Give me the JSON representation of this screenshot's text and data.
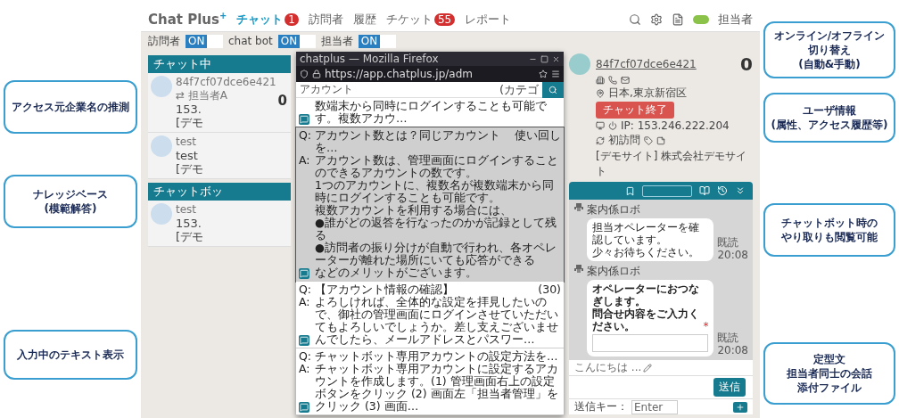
{
  "nav": {
    "logo": "Chat Plus",
    "logo_sup": "+",
    "tabs": [
      {
        "label": "チャット",
        "badge": "1",
        "selected": true
      },
      {
        "label": "訪問者",
        "selected": false
      },
      {
        "label": "履歴",
        "selected": false
      },
      {
        "label": "チケット",
        "badge": "55",
        "selected": false
      },
      {
        "label": "レポート",
        "selected": false
      }
    ],
    "status": {
      "label": "担当者",
      "on": true
    }
  },
  "filters": [
    {
      "label": "訪問者",
      "value": "ON",
      "on": true
    },
    {
      "label": "chat bot",
      "value": "ON",
      "on": true
    },
    {
      "label": "担当者",
      "value": "ON",
      "on": true
    }
  ],
  "sections": [
    {
      "title": "チャット中",
      "items": [
        {
          "name": "84f7cf07dce6e421",
          "assignee": "⇄ 担当者A",
          "count": "0",
          "line2": "153.",
          "line3": "[デモ"
        },
        {
          "name": "test",
          "line2": "test",
          "line3": "[デモ"
        }
      ]
    },
    {
      "title": "チャットボッ",
      "items": [
        {
          "name": "test",
          "line2": "153.",
          "line3": "[デモ"
        }
      ]
    }
  ],
  "popup": {
    "title": "chatplus — Mozilla Firefox",
    "url": "https://app.chatplus.jp/adm",
    "search": "アカウント",
    "category": "(カテゴ",
    "results": [
      {
        "answer": [
          "数端末から同時にログインすることも可能です。複数アカウ…"
        ],
        "selected": false
      },
      {
        "q_label": "Q:",
        "question": "アカウント数とは？同じアカウントを…",
        "tag": "使い回し",
        "a_label": "A:",
        "answer": [
          "アカウント数は、管理画面にログインすることのできるアカウントの数です。",
          "1つのアカウントに、複数名が複数端末から同時にログインすることも可能です。",
          "複数アカウントを利用する場合には、",
          "●誰がどの返答を行なったのかが記録として残る",
          "●訪問者の振り分けが自動で行われ、各オペレーターが離れた場所にいても応答ができる",
          "などのメリットがございます。"
        ],
        "selected": true
      },
      {
        "q_label": "Q:",
        "question": "【アカウント情報の確認】",
        "tag": "(30)",
        "a_label": "A:",
        "answer": [
          "よろしければ、全体的な設定を拝見したいので、御社の管理画面にログインさせていただいてもよろしいでしょうか。差し支えございませんでしたら、メールアドレスとパスワー…"
        ],
        "selected": false
      },
      {
        "q_label": "Q:",
        "question": "チャットボット専用アカウントの設定方法を…",
        "a_label": "A:",
        "answer": [
          "チャットボット専用アカウントに設定するアカウントを作成します。(1) 管理画面右上の設定ボタンをクリック (2) 画面左「担当者管理」をクリック (3) 画面…"
        ],
        "selected": false
      }
    ]
  },
  "visitor": {
    "id": "84f7cf07dce6e421",
    "location": "日本,東京新宿区",
    "end_button": "チャット終了",
    "ip": "IP: 153.246.222.204",
    "visit": "初訪問",
    "company": "[デモサイト] 株式会社デモサイト",
    "count": "0"
  },
  "chat": {
    "messages": [
      {
        "kind": "text",
        "sender": "案内係ロボ",
        "lines": [
          "担当オペレーターを確認しています。",
          "少々お待ちください。"
        ],
        "read": "既読",
        "time": "20:08"
      },
      {
        "kind": "form",
        "sender": "案内係ロボ",
        "lines": [
          "オペレーターにおつなぎします。",
          "問合せ内容をご入力ください。"
        ],
        "required": "*",
        "read": "既読",
        "time": "20:08"
      }
    ],
    "typing": "こんにちは ...",
    "send": "送信",
    "send_key_label": "送信キー：",
    "send_key": "Enter"
  },
  "callouts": [
    {
      "lines": [
        "オンライン/オフライン",
        "切り替え",
        "(自動&手動)"
      ]
    },
    {
      "lines": [
        "アクセス元企業名の推測"
      ]
    },
    {
      "lines": [
        "ユーザ情報",
        "(属性、アクセス履歴等)"
      ]
    },
    {
      "lines": [
        "ナレッジベース",
        "(模範解答)"
      ]
    },
    {
      "lines": [
        "チャットボット時の",
        "やり取りも閲覧可能"
      ]
    },
    {
      "lines": [
        "入力中のテキスト表示"
      ]
    },
    {
      "lines": [
        "定型文",
        "担当者同士の会話",
        "添付ファイル"
      ]
    }
  ]
}
